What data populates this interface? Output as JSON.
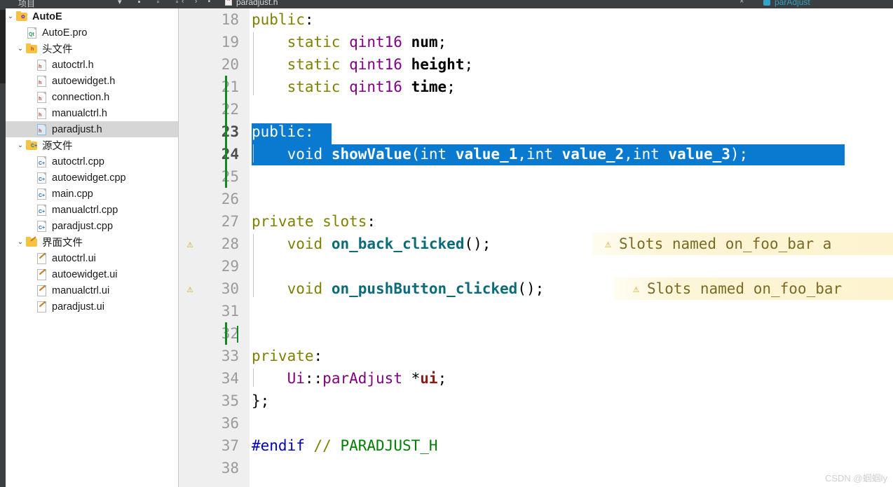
{
  "window": {
    "rail_icon": "activity-rail",
    "tree_panel_title": "项目"
  },
  "tabbar": {
    "nav_back": "‹",
    "nav_forward": "›",
    "split_icon": "split-editor-icon",
    "file_icon": "h-file-icon",
    "file_name": "paradjust.h",
    "close_label": "×",
    "symbol_icon": "class-symbol-icon",
    "symbol_name": "parAdjust"
  },
  "tree": {
    "items": [
      {
        "label": "AutoE",
        "indent": 0,
        "twisty": "⌄",
        "icon": "folder-project-icon",
        "badge": "",
        "bold": true,
        "selected": false
      },
      {
        "label": "AutoE.pro",
        "indent": 1,
        "twisty": "",
        "icon": "file-pro-icon",
        "badge": "Qt",
        "bold": false,
        "selected": false
      },
      {
        "label": "头文件",
        "indent": 1,
        "twisty": "⌄",
        "icon": "folder-headers-icon",
        "badge": "h",
        "bold": false,
        "selected": false
      },
      {
        "label": "autoctrl.h",
        "indent": 2,
        "twisty": "",
        "icon": "file-h-icon",
        "badge": "h",
        "bold": false,
        "selected": false
      },
      {
        "label": "autoewidget.h",
        "indent": 2,
        "twisty": "",
        "icon": "file-h-icon",
        "badge": "h",
        "bold": false,
        "selected": false
      },
      {
        "label": "connection.h",
        "indent": 2,
        "twisty": "",
        "icon": "file-h-icon",
        "badge": "h",
        "bold": false,
        "selected": false
      },
      {
        "label": "manualctrl.h",
        "indent": 2,
        "twisty": "",
        "icon": "file-h-icon",
        "badge": "h",
        "bold": false,
        "selected": false
      },
      {
        "label": "paradjust.h",
        "indent": 2,
        "twisty": "",
        "icon": "file-h-icon",
        "badge": "h",
        "bold": false,
        "selected": true
      },
      {
        "label": "源文件",
        "indent": 1,
        "twisty": "⌄",
        "icon": "folder-sources-icon",
        "badge": "C+",
        "bold": false,
        "selected": false
      },
      {
        "label": "autoctrl.cpp",
        "indent": 2,
        "twisty": "",
        "icon": "file-cpp-icon",
        "badge": "C+",
        "bold": false,
        "selected": false
      },
      {
        "label": "autoewidget.cpp",
        "indent": 2,
        "twisty": "",
        "icon": "file-cpp-icon",
        "badge": "C+",
        "bold": false,
        "selected": false
      },
      {
        "label": "main.cpp",
        "indent": 2,
        "twisty": "",
        "icon": "file-cpp-icon",
        "badge": "C+",
        "bold": false,
        "selected": false
      },
      {
        "label": "manualctrl.cpp",
        "indent": 2,
        "twisty": "",
        "icon": "file-cpp-icon",
        "badge": "C+",
        "bold": false,
        "selected": false
      },
      {
        "label": "paradjust.cpp",
        "indent": 2,
        "twisty": "",
        "icon": "file-cpp-icon",
        "badge": "C+",
        "bold": false,
        "selected": false
      },
      {
        "label": "界面文件",
        "indent": 1,
        "twisty": "⌄",
        "icon": "folder-forms-icon",
        "badge": "",
        "bold": false,
        "selected": false
      },
      {
        "label": "autoctrl.ui",
        "indent": 2,
        "twisty": "",
        "icon": "file-ui-icon",
        "badge": "",
        "bold": false,
        "selected": false
      },
      {
        "label": "autoewidget.ui",
        "indent": 2,
        "twisty": "",
        "icon": "file-ui-icon",
        "badge": "",
        "bold": false,
        "selected": false
      },
      {
        "label": "manualctrl.ui",
        "indent": 2,
        "twisty": "",
        "icon": "file-ui-icon",
        "badge": "",
        "bold": false,
        "selected": false
      },
      {
        "label": "paradjust.ui",
        "indent": 2,
        "twisty": "",
        "icon": "file-ui-icon",
        "badge": "",
        "bold": false,
        "selected": false
      }
    ]
  },
  "editor": {
    "first_visible_line": 18,
    "last_visible_line": 38,
    "selected_lines": [
      23,
      24
    ],
    "cursor_line": 32,
    "warning_lines": [
      28,
      30
    ],
    "changed_line_ranges": [
      [
        21,
        25
      ],
      [
        32,
        32
      ]
    ],
    "warning_marker_glyph": "⚠",
    "warning_message": "Slots named on_foo_bar are error prone",
    "lines": [
      {
        "n": 18,
        "text": "public:"
      },
      {
        "n": 19,
        "text": "    static qint16 num;"
      },
      {
        "n": 20,
        "text": "    static qint16 height;"
      },
      {
        "n": 21,
        "text": "    static qint16 time;"
      },
      {
        "n": 22,
        "text": ""
      },
      {
        "n": 23,
        "text": "public:"
      },
      {
        "n": 24,
        "text": "    void showValue(int value_1,int value_2,int value_3);"
      },
      {
        "n": 25,
        "text": ""
      },
      {
        "n": 26,
        "text": ""
      },
      {
        "n": 27,
        "text": "private slots:"
      },
      {
        "n": 28,
        "text": "    void on_back_clicked();"
      },
      {
        "n": 29,
        "text": ""
      },
      {
        "n": 30,
        "text": "    void on_pushButton_clicked();"
      },
      {
        "n": 31,
        "text": ""
      },
      {
        "n": 32,
        "text": ""
      },
      {
        "n": 33,
        "text": "private:"
      },
      {
        "n": 34,
        "text": "    Ui::parAdjust *ui;"
      },
      {
        "n": 35,
        "text": "};"
      },
      {
        "n": 36,
        "text": ""
      },
      {
        "n": 37,
        "text": "#endif // PARADJUST_H"
      },
      {
        "n": 38,
        "text": ""
      }
    ],
    "warning_text_line28": "Slots named on_foo_bar a",
    "warning_text_line30": "Slots named on_foo_bar"
  },
  "colors": {
    "selection": "#0a7ad1",
    "keyword": "#808000",
    "type": "#800080",
    "function": "#0b6b78",
    "member": "#8b1a1a",
    "preprocessor": "#0000c0",
    "comment": "#008000",
    "warning": "#d8a31a",
    "change_marker": "#0e8a1e",
    "gutter_bg": "#efefef",
    "chrome": "#3c3f41"
  },
  "watermark": {
    "text": "CSDN @蝈蝈ly"
  }
}
